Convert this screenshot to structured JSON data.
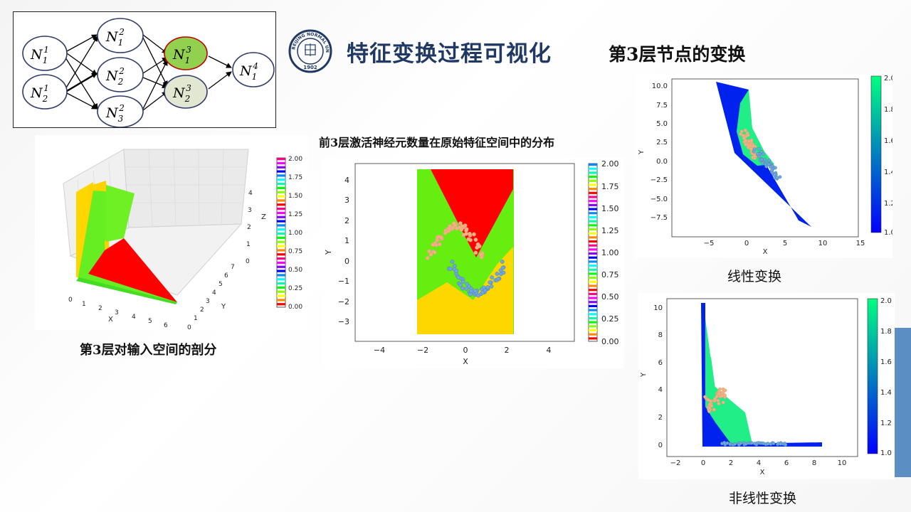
{
  "title": "特征变换过程可视化",
  "subtitle": "第3层节点的变换",
  "logo": {
    "icon": "university-seal-icon",
    "text_top": "BEIJING NORMAL UNIVERSITY",
    "year": "1902",
    "color": "#1f3864"
  },
  "accent_color": "#5b8fc3",
  "network": {
    "nodes": {
      "n11": {
        "base": "N",
        "sub": "1",
        "sup": "1"
      },
      "n21": {
        "base": "N",
        "sub": "2",
        "sup": "1"
      },
      "n12": {
        "base": "N",
        "sub": "1",
        "sup": "2"
      },
      "n22": {
        "base": "N",
        "sub": "2",
        "sup": "2"
      },
      "n32": {
        "base": "N",
        "sub": "3",
        "sup": "2"
      },
      "n13": {
        "base": "N",
        "sub": "1",
        "sup": "3"
      },
      "n23": {
        "base": "N",
        "sub": "2",
        "sup": "3"
      },
      "n14": {
        "base": "N",
        "sub": "1",
        "sup": "4"
      }
    },
    "highlight_fill": "#92d050",
    "highlight_stroke": "#c00000",
    "secondary_fill": "#e2e7d2"
  },
  "plot3d": {
    "caption": "第3层对输入空间的剖分",
    "x_label": "X",
    "y_label": "Y",
    "z_label": "Z",
    "x_ticks": [
      "0",
      "1",
      "2",
      "3",
      "4",
      "5",
      "6"
    ],
    "y_ticks": [
      "0",
      "1",
      "2",
      "3",
      "4",
      "5",
      "6",
      "7"
    ],
    "z_ticks": [
      "0",
      "1",
      "2",
      "3",
      "4"
    ],
    "colorbar_ticks": [
      "2.00",
      "1.75",
      "1.50",
      "1.25",
      "1.00",
      "0.75",
      "0.50",
      "0.25",
      "0.00"
    ]
  },
  "plot_center": {
    "caption": "前3层激活神经元数量在原始特征空间中的分布",
    "x_label": "X",
    "y_label": "Y",
    "x_ticks": [
      "−4",
      "−2",
      "0",
      "2",
      "4"
    ],
    "y_ticks": [
      "4",
      "3",
      "2",
      "1",
      "0",
      "−1",
      "−2",
      "−3"
    ],
    "colorbar_ticks": [
      "2.00",
      "1.75",
      "1.50",
      "1.25",
      "1.00",
      "0.75",
      "0.50",
      "0.25",
      "0.00"
    ]
  },
  "plot_linear": {
    "caption": "线性变换",
    "x_label": "X",
    "y_label": "Y",
    "x_ticks": [
      "−5",
      "0",
      "5",
      "10",
      "15"
    ],
    "y_ticks": [
      "10.0",
      "7.5",
      "5.0",
      "2.5",
      "0.0",
      "−2.5",
      "−5.0",
      "−7.5"
    ],
    "colorbar_ticks": [
      "2.0",
      "1.8",
      "1.6",
      "1.4",
      "1.2",
      "1.0"
    ]
  },
  "plot_nonlinear": {
    "caption": "非线性变换",
    "x_label": "X",
    "y_label": "Y",
    "x_ticks": [
      "−2",
      "0",
      "2",
      "4",
      "6",
      "8",
      "10"
    ],
    "y_ticks": [
      "10",
      "8",
      "6",
      "4",
      "2",
      "0"
    ],
    "colorbar_ticks": [
      "2.0",
      "1.8",
      "1.6",
      "1.4",
      "1.2",
      "1.0"
    ]
  }
}
